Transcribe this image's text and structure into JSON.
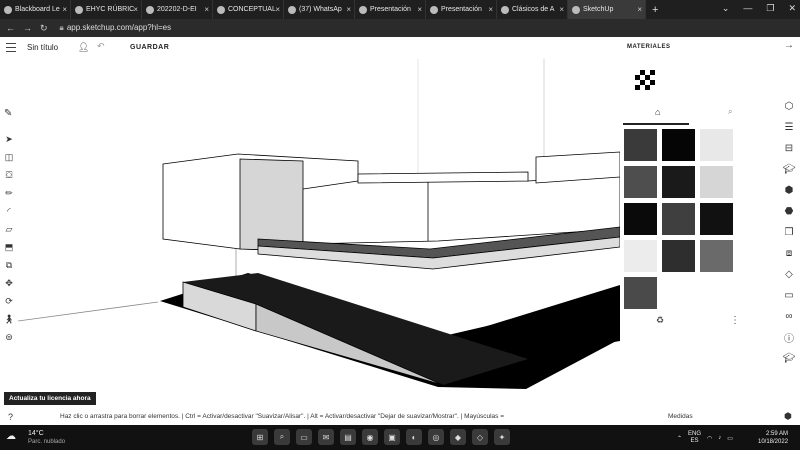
{
  "browser": {
    "tabs": [
      {
        "label": "Blackboard Le"
      },
      {
        "label": "EHYC RÚBRIC"
      },
      {
        "label": "202202-D-EI"
      },
      {
        "label": "CONCEPTUAL"
      },
      {
        "label": "(37) WhatsAp"
      },
      {
        "label": "Presentación"
      },
      {
        "label": "Presentación"
      },
      {
        "label": "Clásicos de A"
      },
      {
        "label": "SketchUp"
      }
    ],
    "new_tab": "+",
    "url": "app.sketchup.com/app?hl=es"
  },
  "app": {
    "title": "Sin título",
    "save_label": "GUARDAR"
  },
  "materials": {
    "title": "MATERIALES",
    "swatch_colors": [
      "#3a3a3a",
      "#050505",
      "#e8e8e8",
      "#4e4e4e",
      "#1a1a1a",
      "#d6d6d6",
      "#0a0a0a",
      "#3f3f3f",
      "#111111",
      "#ececec",
      "#2e2e2e",
      "#6a6a6a",
      "#4a4a4a"
    ]
  },
  "left_tools": [
    "select-icon",
    "eraser-icon",
    "paint-bucket-icon",
    "pencil-icon",
    "arc-icon",
    "rectangle-icon",
    "push-pull-icon",
    "offset-icon",
    "move-icon",
    "rotate-icon",
    "orbit-icon",
    "walk-icon",
    "section-icon"
  ],
  "right_tools": [
    "components-icon",
    "layers-icon",
    "outliner-icon",
    "styles-icon",
    "entity-info-icon",
    "materials-icon",
    "solid-tools-icon",
    "scenes-icon",
    "tape-icon",
    "display-icon",
    "glasses-icon",
    "info-icon",
    "instructor-icon"
  ],
  "status": {
    "help": "?",
    "message": "Haz clic o arrastra para borrar elementos.  | Ctrl = Activar/desactivar \"Suavizar/Alisar\".  | Alt = Activar/desactivar \"Dejar de suavizar/Mostrar\".  | Mayúsculas =",
    "measures_label": "Medidas"
  },
  "upgrade_button": "Actualiza tu licencia ahora",
  "taskbar": {
    "temp": "14°C",
    "weather": "Parc. nublado",
    "lang_line1": "ENG",
    "lang_line2": "ES",
    "time": "2:59 AM",
    "date": "10/18/2022"
  }
}
